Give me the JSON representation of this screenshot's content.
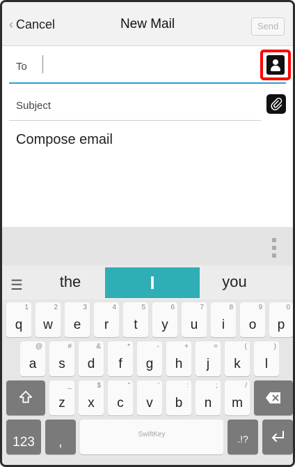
{
  "header": {
    "cancel_label": "Cancel",
    "title": "New Mail",
    "send_label": "Send"
  },
  "fields": {
    "to_label": "To",
    "subject_label": "Subject",
    "compose_placeholder": "Compose email"
  },
  "icons": {
    "contacts": "contact-book-icon",
    "attach": "paperclip-icon",
    "menu": "hamburger-icon",
    "shift": "shift-icon",
    "delete": "backspace-icon",
    "enter": "enter-icon",
    "more": "vertical-dots-icon"
  },
  "keyboard": {
    "predictions": [
      "the",
      "I",
      "you"
    ],
    "row1": [
      {
        "main": "q",
        "sub": "1"
      },
      {
        "main": "w",
        "sub": "2"
      },
      {
        "main": "e",
        "sub": "3"
      },
      {
        "main": "r",
        "sub": "4"
      },
      {
        "main": "t",
        "sub": "5"
      },
      {
        "main": "y",
        "sub": "6"
      },
      {
        "main": "u",
        "sub": "7"
      },
      {
        "main": "i",
        "sub": "8"
      },
      {
        "main": "o",
        "sub": "9"
      },
      {
        "main": "p",
        "sub": "0"
      }
    ],
    "row2": [
      {
        "main": "a",
        "sub": "@"
      },
      {
        "main": "s",
        "sub": "#"
      },
      {
        "main": "d",
        "sub": "&"
      },
      {
        "main": "f",
        "sub": "*"
      },
      {
        "main": "g",
        "sub": "-"
      },
      {
        "main": "h",
        "sub": "+"
      },
      {
        "main": "j",
        "sub": "="
      },
      {
        "main": "k",
        "sub": "("
      },
      {
        "main": "l",
        "sub": ")"
      }
    ],
    "row3": [
      {
        "main": "z",
        "sub": "_"
      },
      {
        "main": "x",
        "sub": "$"
      },
      {
        "main": "c",
        "sub": "\""
      },
      {
        "main": "v",
        "sub": "'"
      },
      {
        "main": "b",
        "sub": ":"
      },
      {
        "main": "n",
        "sub": ";"
      },
      {
        "main": "m",
        "sub": "/"
      }
    ],
    "bottom": {
      "numbers_label": "123",
      "comma_label": ",",
      "space_label": "SwiftKey",
      "punct_label": ".!?"
    }
  },
  "colors": {
    "accent": "#2a9fd6",
    "prediction_highlight": "#2faeb6",
    "highlight_box": "#ff0000"
  }
}
